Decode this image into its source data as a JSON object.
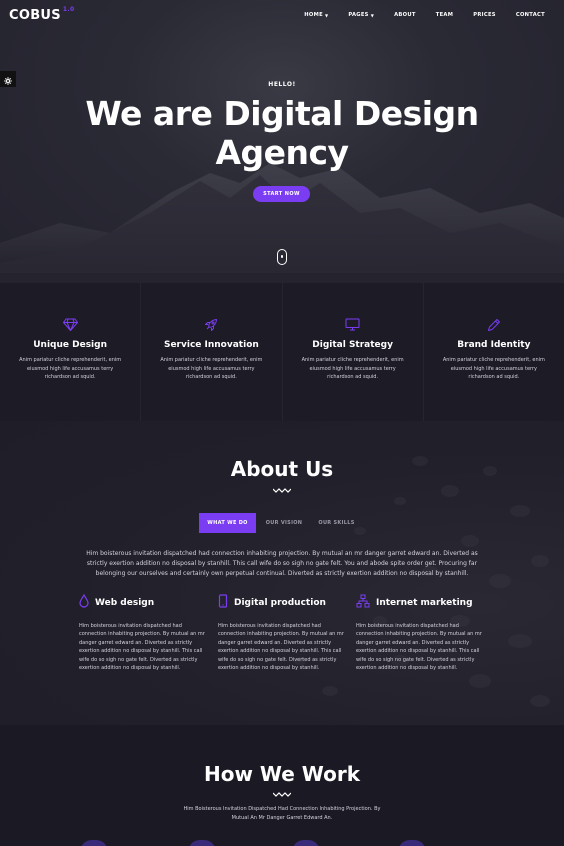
{
  "nav": {
    "logo": "COBUS",
    "logo_version": "1.0",
    "items": [
      {
        "label": "HOME",
        "dropdown": true
      },
      {
        "label": "PAGES",
        "dropdown": true
      },
      {
        "label": "ABOUT",
        "dropdown": false
      },
      {
        "label": "TEAM",
        "dropdown": false
      },
      {
        "label": "PRICES",
        "dropdown": false
      },
      {
        "label": "CONTACT",
        "dropdown": false
      }
    ]
  },
  "hero": {
    "eyebrow": "HELLO!",
    "title": "We are Digital Design Agency",
    "button": "START NOW"
  },
  "features": [
    {
      "icon": "diamond-icon",
      "title": "Unique Design",
      "text": "Anim pariatur cliche reprehenderit, enim eiusmod high life accusamus terry richardson ad squid."
    },
    {
      "icon": "rocket-icon",
      "title": "Service Innovation",
      "text": "Anim pariatur cliche reprehenderit, enim eiusmod high life accusamus terry richardson ad squid."
    },
    {
      "icon": "monitor-icon",
      "title": "Digital Strategy",
      "text": "Anim pariatur cliche reprehenderit, enim eiusmod high life accusamus terry richardson ad squid."
    },
    {
      "icon": "pencil-icon",
      "title": "Brand Identity",
      "text": "Anim pariatur cliche reprehenderit, enim eiusmod high life accusamus terry richardson ad squid."
    }
  ],
  "about": {
    "title": "About Us",
    "tabs": [
      "WHAT WE DO",
      "OUR VISION",
      "OUR SKILLS"
    ],
    "active_tab": "WHAT WE DO",
    "intro": "Him boisterous invitation dispatched had connection inhabiting projection. By mutual an mr danger garret edward an. Diverted as strictly exertion addition no disposal by stanhill. This call wife do so sigh no gate felt. You and abode spite order get. Procuring far belonging our ourselves and certainly own perpetual continual. Diverted as strictly exertion addition no disposal by stanhill.",
    "services": [
      {
        "icon": "drop-icon",
        "title": "Web design",
        "text": "Him boisterous invitation dispatched had connection inhabiting projection. By mutual an mr danger garret edward an. Diverted as strictly exertion addition no disposal by stanhill. This call wife do so sigh no gate felt. Diverted as strictly exertion addition no disposal by stanhill."
      },
      {
        "icon": "mobile-icon",
        "title": "Digital production",
        "text": "Him boisterous invitation dispatched had connection inhabiting projection. By mutual an mr danger garret edward an. Diverted as strictly exertion addition no disposal by stanhill. This call wife do so sigh no gate felt. Diverted as strictly exertion addition no disposal by stanhill."
      },
      {
        "icon": "sitemap-icon",
        "title": "Internet marketing",
        "text": "Him boisterous invitation dispatched had connection inhabiting projection. By mutual an mr danger garret edward an. Diverted as strictly exertion addition no disposal by stanhill. This call wife do so sigh no gate felt. Diverted as strictly exertion addition no disposal by stanhill."
      }
    ]
  },
  "how": {
    "title": "How We Work",
    "subtitle": "Him Boisterous Invitation Dispatched Had Connection Inhabiting Projection. By Mutual An Mr Danger Garret Edward An."
  },
  "colors": {
    "accent": "#7b3df2",
    "background": "#1b1a24"
  }
}
